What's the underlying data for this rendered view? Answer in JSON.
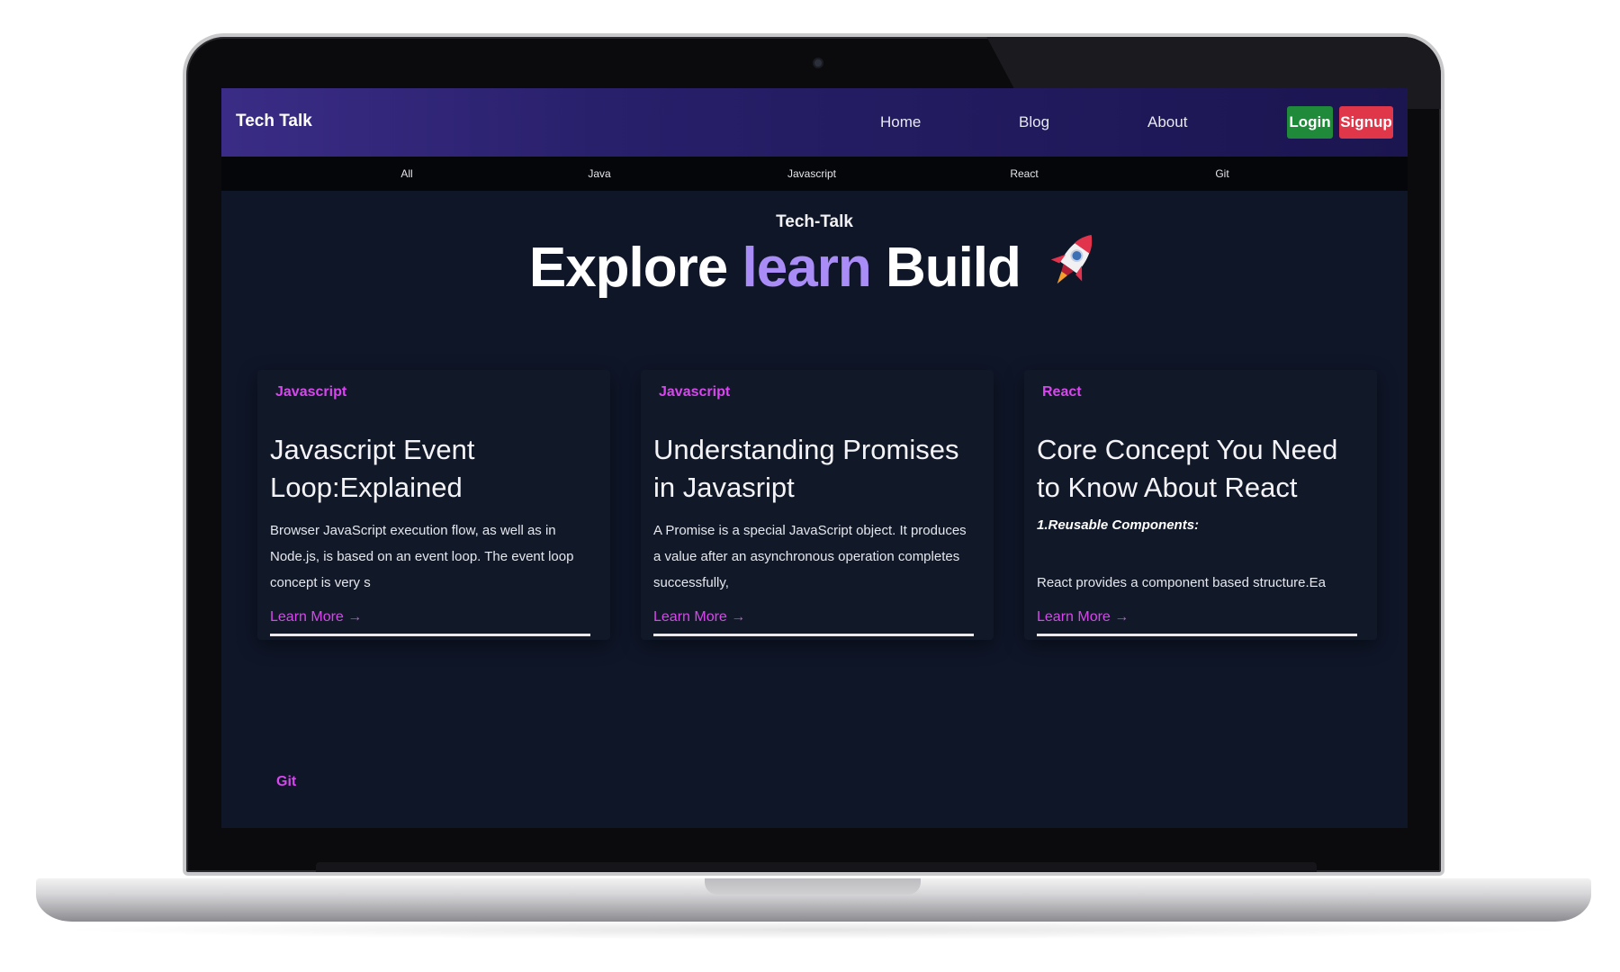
{
  "navbar": {
    "brand": "Tech Talk",
    "links": [
      "Home",
      "Blog",
      "About"
    ],
    "login_label": "Login",
    "signup_label": "Signup"
  },
  "categories": [
    "All",
    "Java",
    "Javascript",
    "React",
    "Git"
  ],
  "hero": {
    "eyebrow": "Tech-Talk",
    "word_1": "Explore",
    "word_2": "learn",
    "word_3": "Build",
    "rocket_icon": "rocket-icon"
  },
  "cards": [
    {
      "tag": "Javascript",
      "title": "Javascript Event Loop:Explained",
      "description": "Browser JavaScript execution flow, as well as in Node.js, is based on an event loop. The event loop concept is very s",
      "link": "Learn More →"
    },
    {
      "tag": "Javascript",
      "title": "Understanding Promises in Javasript",
      "description": "A Promise is a special JavaScript object. It produces a value after an asynchronous operation completes successfully,",
      "link": "Learn More →"
    },
    {
      "tag": "React",
      "title": "Core Concept You Need to Know About React",
      "subheading": "1.Reusable Components:",
      "description": "React provides a component based structure.Ea",
      "link": "Learn More →"
    }
  ],
  "next_card_tag": "Git",
  "colors": {
    "accent": "#a98cf5",
    "tag": "#d946ef",
    "login": "#1f8a3a",
    "signup": "#e0364a",
    "background": "#0f1628"
  }
}
